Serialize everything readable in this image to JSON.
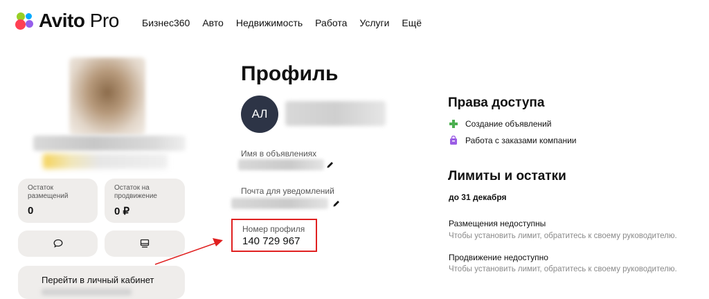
{
  "header": {
    "logo": "Avito Pro",
    "logo_main": "Avito",
    "logo_suffix": "Pro",
    "nav": [
      "Бизнес360",
      "Авто",
      "Недвижимость",
      "Работа",
      "Услуги",
      "Ещё"
    ]
  },
  "sidebar": {
    "stats": [
      {
        "label": "Остаток размещений",
        "value": "0"
      },
      {
        "label": "Остаток на продвижение",
        "value": "0 ₽"
      }
    ],
    "buttons": {
      "messages_icon": "chat-bubble-icon",
      "dashboard_icon": "monitor-icon"
    },
    "cabinet_button": "Перейти в личный кабинет"
  },
  "profile": {
    "title": "Профиль",
    "initials": "АЛ",
    "listing_name_label": "Имя в объявлениях",
    "notification_email_label": "Почта для уведомлений",
    "profile_number_label": "Номер профиля",
    "profile_number": "140 729 967"
  },
  "access": {
    "title": "Права доступа",
    "items": [
      {
        "label": "Создание объявлений",
        "icon": "plus-icon",
        "color": "#4caf50"
      },
      {
        "label": "Работа с заказами компании",
        "icon": "shopping-bag-icon",
        "color": "#9b5de5"
      }
    ]
  },
  "limits": {
    "title": "Лимиты и остатки",
    "period": "до 31 декабря",
    "entries": [
      {
        "title": "Размещения недоступны",
        "desc": "Чтобы установить лимит, обратитесь к своему руководителю."
      },
      {
        "title": "Продвижение недоступно",
        "desc": "Чтобы установить лимит, обратитесь к своему руководителю."
      }
    ]
  },
  "colors": {
    "highlight": "#e02020",
    "avatar_bg": "#2d3446",
    "card_bg": "#efedeb"
  }
}
